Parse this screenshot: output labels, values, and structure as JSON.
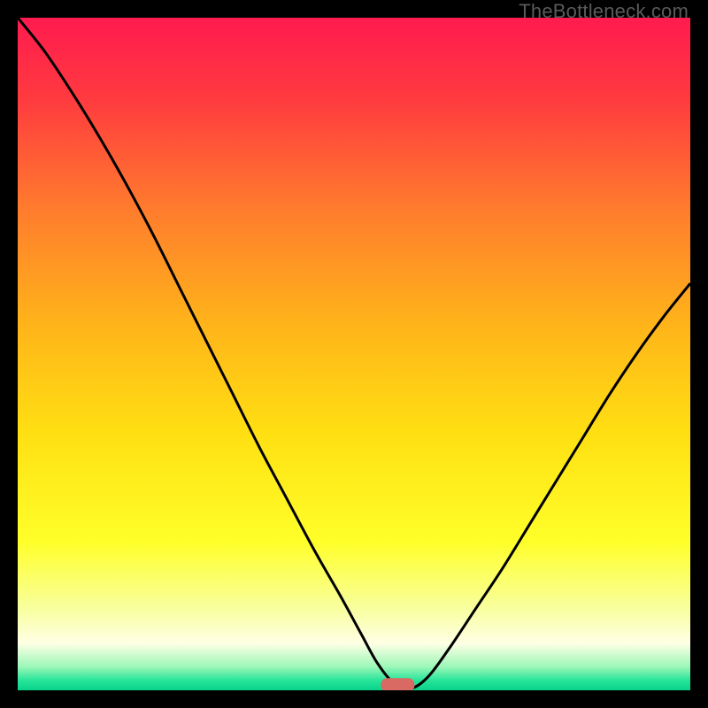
{
  "watermark": "TheBottleneck.com",
  "chart_data": {
    "type": "line",
    "title": "",
    "xlabel": "",
    "ylabel": "",
    "xlim": [
      0,
      100
    ],
    "ylim": [
      0,
      100
    ],
    "background_gradient": {
      "stops": [
        {
          "offset": 0.0,
          "color": "#ff1b4f"
        },
        {
          "offset": 0.12,
          "color": "#ff3a3f"
        },
        {
          "offset": 0.28,
          "color": "#ff7a2e"
        },
        {
          "offset": 0.45,
          "color": "#ffb21a"
        },
        {
          "offset": 0.62,
          "color": "#ffe012"
        },
        {
          "offset": 0.78,
          "color": "#ffff2a"
        },
        {
          "offset": 0.88,
          "color": "#f8ffa0"
        },
        {
          "offset": 0.93,
          "color": "#ffffe5"
        },
        {
          "offset": 0.965,
          "color": "#9cf7b8"
        },
        {
          "offset": 0.985,
          "color": "#28e59a"
        },
        {
          "offset": 1.0,
          "color": "#08d28b"
        }
      ]
    },
    "series": [
      {
        "name": "bottleneck-curve",
        "x": [
          0.0,
          4.0,
          8.0,
          12.0,
          16.0,
          20.0,
          24.0,
          28.0,
          32.0,
          36.0,
          40.0,
          44.0,
          48.0,
          51.0,
          53.5,
          56.0,
          58.5,
          61.0,
          64.0,
          68.0,
          72.0,
          76.0,
          80.0,
          84.0,
          88.0,
          92.0,
          96.0,
          100.0
        ],
        "y": [
          100.0,
          95.0,
          89.0,
          82.5,
          75.5,
          68.0,
          60.0,
          52.0,
          44.0,
          36.0,
          28.5,
          21.0,
          14.0,
          8.5,
          4.0,
          1.0,
          0.3,
          2.0,
          6.0,
          12.0,
          18.0,
          24.5,
          31.0,
          37.5,
          44.0,
          50.0,
          55.5,
          60.5
        ]
      }
    ],
    "marker": {
      "name": "optimal-point",
      "x": 56.5,
      "y": 0.8,
      "width_pct": 5.0,
      "height_pct": 2.0,
      "fill": "#d96a63"
    }
  }
}
